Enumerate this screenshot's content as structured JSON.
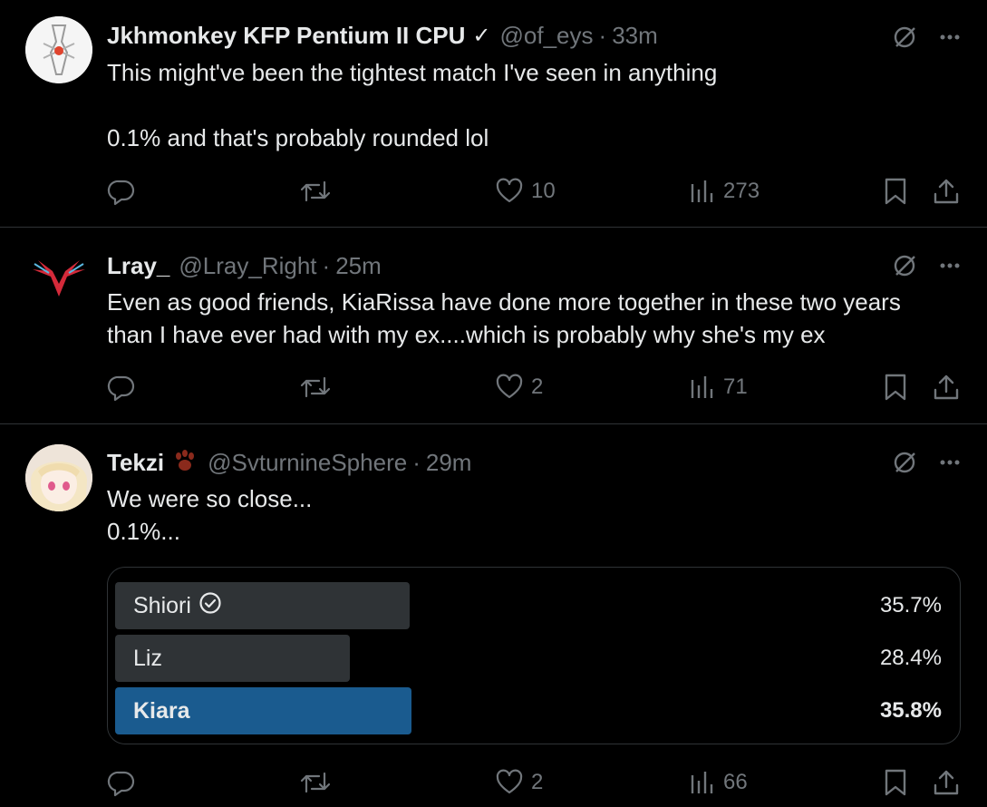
{
  "tweets": [
    {
      "name": "Jkhmonkey KFP Pentium II CPU",
      "badge": "✓",
      "handle": "@of_eys",
      "time": "33m",
      "text": "This might've been the tightest match I've seen in anything\n\n0.1% and that's probably rounded lol",
      "likes": "10",
      "views": "273"
    },
    {
      "name": "Lray_",
      "handle": "@Lray_Right",
      "time": "25m",
      "text": "Even as good friends, KiaRissa have done more together in these two years\nthan I have ever had with my ex....which is probably why she's my ex",
      "likes": "2",
      "views": "71"
    },
    {
      "name": "Tekzi",
      "badge_icon": "paw-icon",
      "handle": "@SvturnineSphere",
      "time": "29m",
      "text": "We were so close...\n0.1%...",
      "likes": "2",
      "views": "66",
      "poll": {
        "options": [
          {
            "label": "Shiori",
            "pct": "35.7%",
            "fill": 0.357,
            "voted": true
          },
          {
            "label": "Liz",
            "pct": "28.4%",
            "fill": 0.284,
            "voted": false
          },
          {
            "label": "Kiara",
            "pct": "35.8%",
            "fill": 0.358,
            "winner": true
          }
        ]
      }
    }
  ],
  "separator": "·",
  "colors": {
    "background": "#000000",
    "text": "#e7e9ea",
    "muted": "#71767b",
    "divider": "#2f3336",
    "poll_bar": "#2f3336",
    "poll_winner": "#1a5b8f"
  },
  "icons": [
    "grok-icon",
    "more-icon",
    "reply-icon",
    "repost-icon",
    "like-icon",
    "views-icon",
    "bookmark-icon",
    "share-icon"
  ]
}
